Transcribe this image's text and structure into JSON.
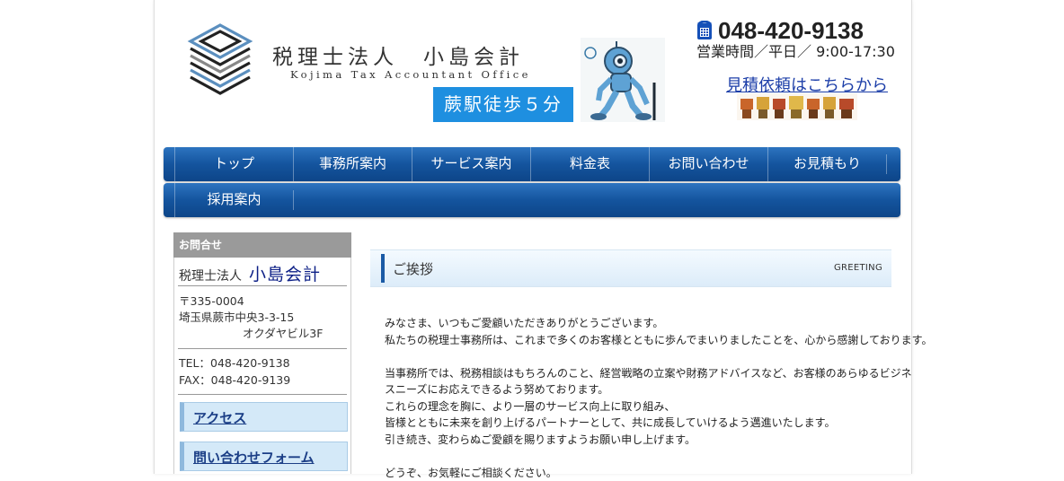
{
  "header": {
    "firm_name": "税理士法人　小島会計",
    "firm_name_en": "Kojima  Tax  Accountant  Office",
    "station_badge": "蕨駅徒歩５分",
    "phone": "048-420-9138",
    "hours": "営業時間／平日／ 9:00-17:30",
    "estimate_link": "見積依頼はこちらから",
    "phone_icon": "telephone-icon"
  },
  "nav": {
    "row1": [
      "トップ",
      "事務所案内",
      "サービス案内",
      "料金表",
      "お問い合わせ",
      "お見積もり"
    ],
    "row2": [
      "採用案内"
    ]
  },
  "sidebar": {
    "heading": "お問合せ",
    "firm_prefix": "税理士法人",
    "firm_name": "小島会計",
    "postal": "〒335-0004",
    "address1": "埼玉県蕨市中央3-3-15",
    "address2": "オクダヤビル3F",
    "tel": "TEL：048-420-9138",
    "fax": "FAX：048-420-9139",
    "links": [
      "アクセス",
      "問い合わせフォーム"
    ]
  },
  "main": {
    "section_title": "ご挨拶",
    "section_title_en": "GREETING",
    "paragraphs": [
      "みなさま、いつもご愛顧いただきありがとうございます。",
      "私たちの税理士事務所は、これまで多くのお客様とともに歩んでまいりましたことを、心から感謝しております。",
      "当事務所では、税務相談はもちろんのこと、経営戦略の立案や財務アドバイスなど、お客様のあらゆるビジネ",
      "スニーズにお応えできるよう努めております。",
      "これらの理念を胸に、より一層のサービス向上に取り組み、",
      "皆様とともに未来を創り上げるパートナーとして、共に成長していけるよう邁進いたします。",
      "引き続き、変わらぬご愛顧を賜りますようお願い申し上げます。",
      "どうぞ、お気軽にご相談ください。"
    ]
  },
  "colors": {
    "nav_blue": "#14549e",
    "badge_blue": "#1e8fe0",
    "link_blue": "#1c3ea8",
    "sidebar_link_bg": "#d4e9f8"
  }
}
